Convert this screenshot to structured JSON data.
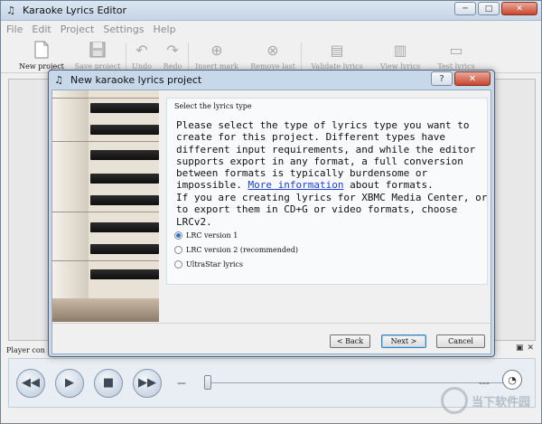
{
  "app": {
    "title": "Karaoke Lyrics Editor"
  },
  "window_controls": {
    "minimize": "─",
    "maximize": "□",
    "close": "✕"
  },
  "menu": [
    "File",
    "Edit",
    "Project",
    "Settings",
    "Help"
  ],
  "toolbar": {
    "new_project": "New project",
    "save_project": "Save project",
    "undo": "Undo",
    "redo": "Redo",
    "insert_mark": "Insert mark",
    "remove_last": "Remove last",
    "validate_lyrics": "Validate lyrics",
    "view_lyrics": "View lyrics",
    "test_lyrics": "Test lyrics"
  },
  "player": {
    "label": "Player con",
    "time_start": "---",
    "time_end": "---",
    "panel_restore": "▣",
    "panel_close": "✕"
  },
  "dialog": {
    "title": "New karaoke lyrics project",
    "help": "?",
    "close": "✕",
    "group_title": "Select the lyrics type",
    "para1_a": "Please select the type of lyrics type you want to create for this project. Different types have different input requirements, and while the editor supports export in any format, a full conversion between formats is typically burdensome or impossible. ",
    "para1_link": "More information",
    "para1_b": " about formats.",
    "para2": "If you are creating lyrics for XBMC Media Center, or to export them in CD+G or video formats, choose LRCv2.",
    "options": [
      {
        "label": "LRC version 1",
        "checked": true
      },
      {
        "label": "LRC version 2 (recommended)",
        "checked": false
      },
      {
        "label": "UltraStar lyrics",
        "checked": false
      }
    ],
    "back": "< Back",
    "next": "Next >",
    "cancel": "Cancel"
  },
  "watermark": {
    "text": "当下软件园"
  }
}
